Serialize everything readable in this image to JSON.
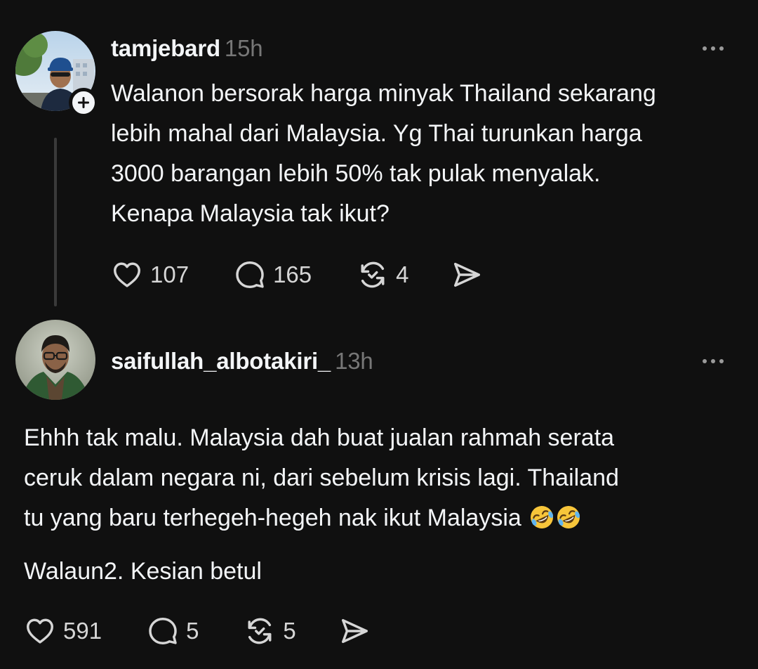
{
  "posts": [
    {
      "username": "tamjebard",
      "time": "15h",
      "text": "Walanon bersorak harga minyak Thailand sekarang\nlebih mahal dari Malaysia. Yg Thai turunkan harga\n3000 barangan lebih 50% tak pulak menyalak.\nKenapa Malaysia tak ikut?",
      "likes": "107",
      "replies": "165",
      "reposts": "4"
    },
    {
      "username": "saifullah_albotakiri_",
      "time": "13h",
      "text_line1": "Ehhh tak malu. Malaysia dah buat jualan rahmah serata",
      "text_line2": "ceruk dalam negara ni, dari sebelum krisis lagi. Thailand",
      "text_line3": "tu yang baru terhegeh-hegeh nak ikut Malaysia",
      "text_line4": "Walaun2. Kesian betul",
      "likes": "591",
      "replies": "5",
      "reposts": "5"
    }
  ],
  "icons": {
    "like": "heart-icon",
    "reply": "comment-icon",
    "repost": "repost-icon",
    "share": "send-icon",
    "more": "more-options-icon",
    "follow": "plus-icon",
    "emoji": "rolling-on-floor-laughing-emoji"
  },
  "colors": {
    "background": "#101010",
    "text": "#f3f5f7",
    "secondary": "#777777",
    "thread_line": "#3a3a3a"
  }
}
